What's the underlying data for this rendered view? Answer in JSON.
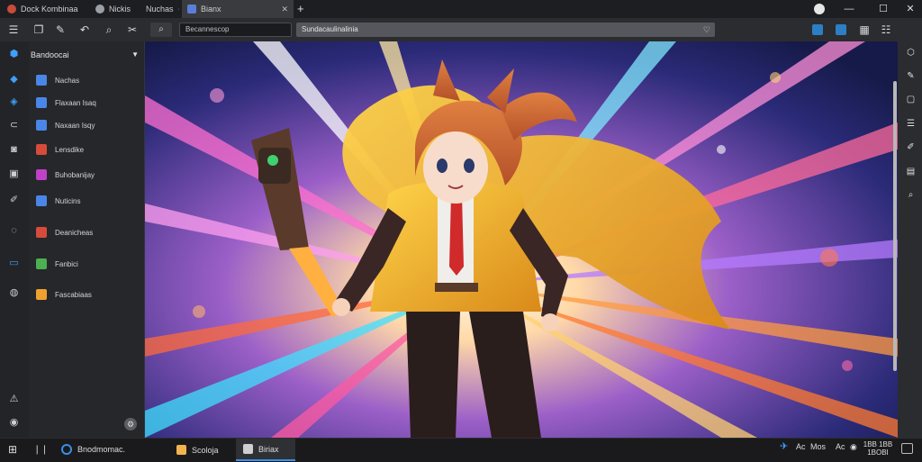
{
  "tabs": [
    {
      "label": "Dock Kombinaa",
      "active": false,
      "color": "#c94b3a"
    },
    {
      "label": "Nickis",
      "active": false,
      "color": "#9aa0a6"
    },
    {
      "label": "Nuchas",
      "active": false,
      "color": "#9aa0a6"
    },
    {
      "label": "Bianx",
      "active": true,
      "color": "#5a7fd8"
    }
  ],
  "newtab_label": "+",
  "window_controls": {
    "minimize": "—",
    "maximize": "☐",
    "close": "✕"
  },
  "toolbar": {
    "address_prefix_icon": "search-icon",
    "address_left": "Becannescop",
    "address_main": "Sundacaulinalinia"
  },
  "sidebar": {
    "header": "Bandoocai",
    "items": [
      {
        "label": "Nachas",
        "color": "#4a86e8"
      },
      {
        "label": "Flaxaan Isaq",
        "color": "#4a86e8"
      },
      {
        "label": "Naxaan Isqy",
        "color": "#4a86e8"
      },
      {
        "label": "Lensdike",
        "color": "#d64b3b"
      },
      {
        "label": "Buhobanijay",
        "color": "#c040c8"
      },
      {
        "label": "Nuticins",
        "color": "#4a86e8"
      },
      {
        "label": "Deanicheas",
        "color": "#d64b3b"
      },
      {
        "label": "Fanbici",
        "color": "#4caf50"
      },
      {
        "label": "Fascabiaas",
        "color": "#f0a030"
      }
    ]
  },
  "taskbar": {
    "search_label": "Bnodmomac.",
    "apps": [
      {
        "label": "Scoloja",
        "active": false,
        "color": "#f0b450"
      },
      {
        "label": "Biriax",
        "active": true,
        "color": "#cfcfcf"
      }
    ],
    "tray_labels": [
      "Ac",
      "Mos",
      "Ac"
    ],
    "clock_time": "1BB 1BB",
    "clock_date": "1BOBI"
  },
  "colors": {
    "accent": "#3a8ee6",
    "chrome_bg": "#202124"
  }
}
